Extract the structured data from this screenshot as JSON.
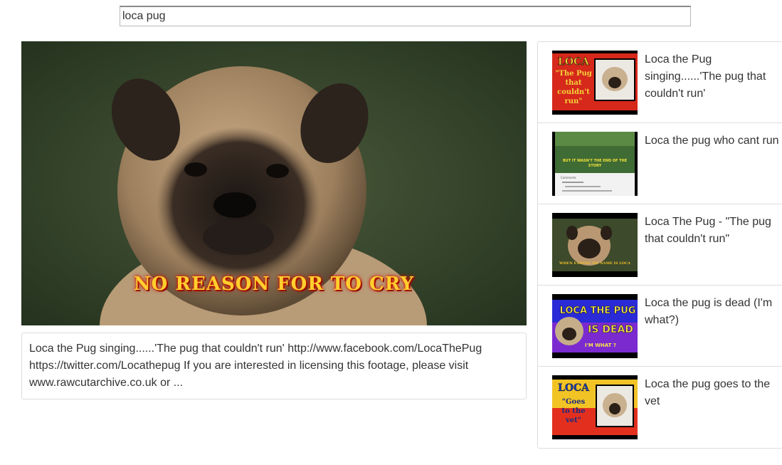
{
  "search": {
    "value": "loca pug",
    "placeholder": ""
  },
  "player": {
    "subtitle": "NO REASON FOR TO CRY"
  },
  "description": {
    "title": "Loca the Pug singing......'The pug that couldn't run'",
    "body": "http://www.facebook.com/LocaThePug https://twitter.com/Locathepug If you are interested in licensing this footage, please visit www.rawcutarchive.co.uk or ..."
  },
  "related": [
    {
      "title": "Loca the Pug singing......'The pug that couldn't run'",
      "thumb_text": [
        "LOCA",
        "\"The Pug",
        "that",
        "couldn't",
        "run\""
      ]
    },
    {
      "title": "Loca the pug who cant run",
      "thumb_text": [
        "BUT IT WASN'T THE END OF THE",
        "STORY",
        "Comments"
      ]
    },
    {
      "title": "Loca The Pug - \"The pug that couldn't run\"",
      "thumb_text": [
        "WHEN ENDING MY NAME IS LOCA"
      ]
    },
    {
      "title": "Loca the pug is dead (I'm what?)",
      "thumb_text": [
        "LOCA THE PUG",
        "IS DEAD",
        "I'M WHAT ?"
      ]
    },
    {
      "title": "Loca the pug goes to the vet",
      "thumb_text": [
        "LOCA",
        "\"Goes",
        "to the",
        "vet\""
      ]
    }
  ]
}
